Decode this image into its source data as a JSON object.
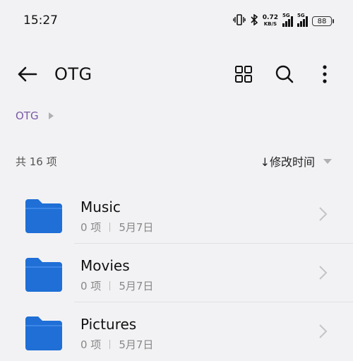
{
  "status_bar": {
    "time": "15:27",
    "net_speed_value": "0.72",
    "net_speed_unit": "KB/S",
    "sim1_label": "5G",
    "sim2_label": "5G",
    "battery": "88"
  },
  "app_bar": {
    "title": "OTG"
  },
  "breadcrumb": {
    "items": [
      "OTG"
    ]
  },
  "listing": {
    "count_label": "共 16 项",
    "sort_label": "↓修改时间"
  },
  "folders": [
    {
      "name": "Music",
      "items": "0 项",
      "date": "5月7日"
    },
    {
      "name": "Movies",
      "items": "0 项",
      "date": "5月7日"
    },
    {
      "name": "Pictures",
      "items": "0 项",
      "date": "5月7日"
    }
  ],
  "colors": {
    "background": "#f2f2f4",
    "folder_blue": "#1f6fd6",
    "breadcrumb_accent": "#7a5aa6"
  }
}
